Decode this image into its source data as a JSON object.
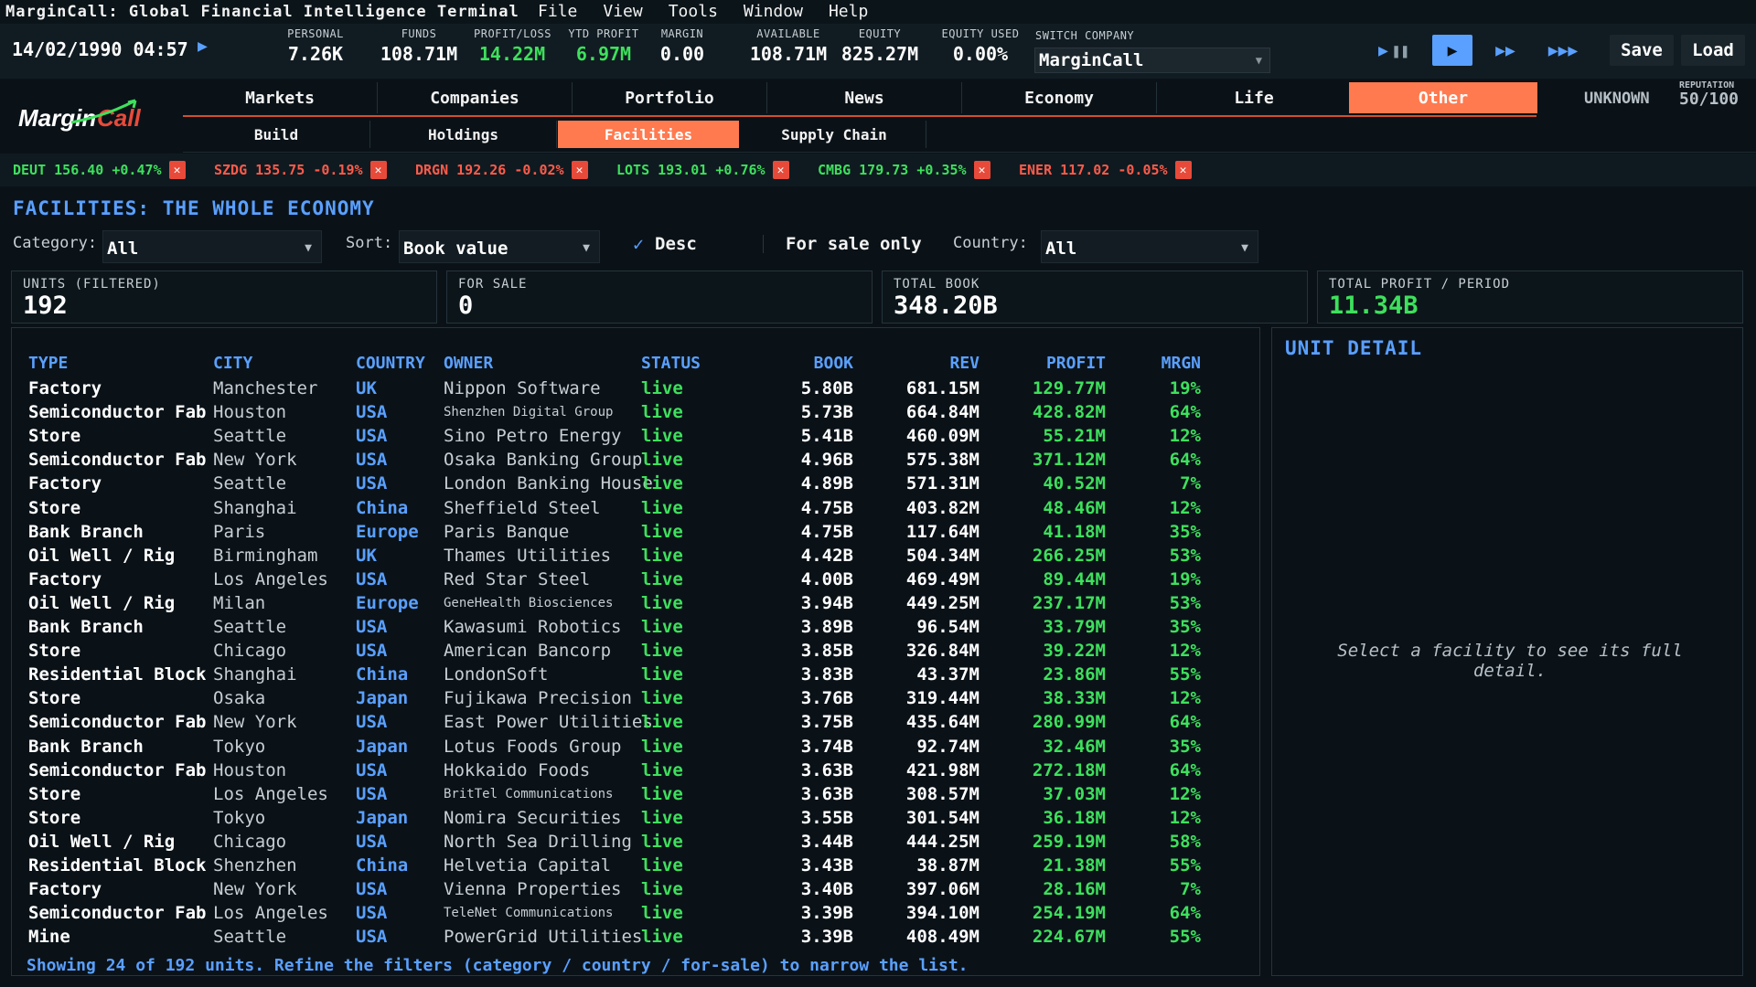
{
  "app": {
    "title": "MarginCall: Global Financial Intelligence Terminal",
    "menus": [
      "File",
      "View",
      "Tools",
      "Window",
      "Help"
    ]
  },
  "status": {
    "datetime": "14/02/1990 04:57",
    "stats": [
      {
        "label": "PERSONAL",
        "value": "7.26K",
        "color": "white"
      },
      {
        "label": "FUNDS",
        "value": "108.71M",
        "color": "white"
      },
      {
        "label": "PROFIT/LOSS",
        "value": "14.22M",
        "color": "green"
      },
      {
        "label": "YTD PROFIT",
        "value": "6.97M",
        "color": "green"
      },
      {
        "label": "MARGIN",
        "value": "0.00",
        "color": "white"
      },
      {
        "label": "AVAILABLE",
        "value": "108.71M",
        "color": "white"
      },
      {
        "label": "EQUITY",
        "value": "825.27M",
        "color": "white"
      },
      {
        "label": "EQUITY USED",
        "value": "0.00%",
        "color": "white"
      }
    ],
    "switch_company_label": "SWITCH COMPANY",
    "switch_company_value": "MarginCall",
    "save_label": "Save",
    "load_label": "Load"
  },
  "nav": {
    "tabs": [
      "Markets",
      "Companies",
      "Portfolio",
      "News",
      "Economy",
      "Life",
      "Other"
    ],
    "active_tab": "Other",
    "subtabs": [
      "Build",
      "Holdings",
      "Facilities",
      "Supply Chain"
    ],
    "active_subtab": "Facilities",
    "player_status": "UNKNOWN",
    "reputation_label": "REPUTATION",
    "reputation_value": "50/100"
  },
  "ticker": [
    {
      "text": "DEUT 156.40 +0.47%",
      "dir": "up"
    },
    {
      "text": "SZDG 135.75 -0.19%",
      "dir": "down"
    },
    {
      "text": "DRGN 192.26 -0.02%",
      "dir": "down"
    },
    {
      "text": "LOTS 193.01 +0.76%",
      "dir": "up"
    },
    {
      "text": "CMBG 179.73 +0.35%",
      "dir": "up"
    },
    {
      "text": "ENER 117.02 -0.05%",
      "dir": "down"
    }
  ],
  "page": {
    "title": "FACILITIES: THE WHOLE ECONOMY",
    "filters": {
      "category_label": "Category:",
      "category_value": "All",
      "sort_label": "Sort:",
      "sort_value": "Book value",
      "desc_label": "Desc",
      "desc_checked": true,
      "for_sale_label": "For sale only",
      "for_sale_checked": false,
      "country_label": "Country:",
      "country_value": "All"
    },
    "cards": [
      {
        "label": "UNITS (FILTERED)",
        "value": "192"
      },
      {
        "label": "FOR SALE",
        "value": "0"
      },
      {
        "label": "TOTAL BOOK",
        "value": "348.20B"
      },
      {
        "label": "TOTAL PROFIT / PERIOD",
        "value": "11.34B"
      }
    ]
  },
  "table": {
    "headers": [
      "TYPE",
      "CITY",
      "COUNTRY",
      "OWNER",
      "STATUS",
      "BOOK",
      "REV",
      "PROFIT",
      "MRGN"
    ],
    "rows": [
      [
        "Factory",
        "Manchester",
        "UK",
        "Nippon Software",
        "live",
        "5.80B",
        "681.15M",
        "129.77M",
        "19%"
      ],
      [
        "Semiconductor Fab",
        "Houston",
        "USA",
        "Shenzhen Digital Group",
        "live",
        "5.73B",
        "664.84M",
        "428.82M",
        "64%"
      ],
      [
        "Store",
        "Seattle",
        "USA",
        "Sino Petro Energy",
        "live",
        "5.41B",
        "460.09M",
        "55.21M",
        "12%"
      ],
      [
        "Semiconductor Fab",
        "New York",
        "USA",
        "Osaka Banking Group",
        "live",
        "4.96B",
        "575.38M",
        "371.12M",
        "64%"
      ],
      [
        "Factory",
        "Seattle",
        "USA",
        "London Banking House",
        "live",
        "4.89B",
        "571.31M",
        "40.52M",
        "7%"
      ],
      [
        "Store",
        "Shanghai",
        "China",
        "Sheffield Steel",
        "live",
        "4.75B",
        "403.82M",
        "48.46M",
        "12%"
      ],
      [
        "Bank Branch",
        "Paris",
        "Europe",
        "Paris Banque",
        "live",
        "4.75B",
        "117.64M",
        "41.18M",
        "35%"
      ],
      [
        "Oil Well / Rig",
        "Birmingham",
        "UK",
        "Thames Utilities",
        "live",
        "4.42B",
        "504.34M",
        "266.25M",
        "53%"
      ],
      [
        "Factory",
        "Los Angeles",
        "USA",
        "Red Star Steel",
        "live",
        "4.00B",
        "469.49M",
        "89.44M",
        "19%"
      ],
      [
        "Oil Well / Rig",
        "Milan",
        "Europe",
        "GeneHealth Biosciences",
        "live",
        "3.94B",
        "449.25M",
        "237.17M",
        "53%"
      ],
      [
        "Bank Branch",
        "Seattle",
        "USA",
        "Kawasumi Robotics",
        "live",
        "3.89B",
        "96.54M",
        "33.79M",
        "35%"
      ],
      [
        "Store",
        "Chicago",
        "USA",
        "American Bancorp",
        "live",
        "3.85B",
        "326.84M",
        "39.22M",
        "12%"
      ],
      [
        "Residential Block",
        "Shanghai",
        "China",
        "LondonSoft",
        "live",
        "3.83B",
        "43.37M",
        "23.86M",
        "55%"
      ],
      [
        "Store",
        "Osaka",
        "Japan",
        "Fujikawa Precision",
        "live",
        "3.76B",
        "319.44M",
        "38.33M",
        "12%"
      ],
      [
        "Semiconductor Fab",
        "New York",
        "USA",
        "East Power Utilities",
        "live",
        "3.75B",
        "435.64M",
        "280.99M",
        "64%"
      ],
      [
        "Bank Branch",
        "Tokyo",
        "Japan",
        "Lotus Foods Group",
        "live",
        "3.74B",
        "92.74M",
        "32.46M",
        "35%"
      ],
      [
        "Semiconductor Fab",
        "Houston",
        "USA",
        "Hokkaido Foods",
        "live",
        "3.63B",
        "421.98M",
        "272.18M",
        "64%"
      ],
      [
        "Store",
        "Los Angeles",
        "USA",
        "BritTel Communications",
        "live",
        "3.63B",
        "308.57M",
        "37.03M",
        "12%"
      ],
      [
        "Store",
        "Tokyo",
        "Japan",
        "Nomira Securities",
        "live",
        "3.55B",
        "301.54M",
        "36.18M",
        "12%"
      ],
      [
        "Oil Well / Rig",
        "Chicago",
        "USA",
        "North Sea Drilling",
        "live",
        "3.44B",
        "444.25M",
        "259.19M",
        "58%"
      ],
      [
        "Residential Block",
        "Shenzhen",
        "China",
        "Helvetia Capital",
        "live",
        "3.43B",
        "38.87M",
        "21.38M",
        "55%"
      ],
      [
        "Factory",
        "New York",
        "USA",
        "Vienna Properties",
        "live",
        "3.40B",
        "397.06M",
        "28.16M",
        "7%"
      ],
      [
        "Semiconductor Fab",
        "Los Angeles",
        "USA",
        "TeleNet Communications",
        "live",
        "3.39B",
        "394.10M",
        "254.19M",
        "64%"
      ],
      [
        "Mine",
        "Seattle",
        "USA",
        "PowerGrid Utilities",
        "live",
        "3.39B",
        "408.49M",
        "224.67M",
        "55%"
      ]
    ],
    "footer": "Showing 24 of 192 units. Refine the filters (category / country / for-sale) to narrow the list."
  },
  "detail": {
    "title": "UNIT DETAIL",
    "placeholder": "Select a facility to see its full detail."
  },
  "colors": {
    "accent": "#ff7a4f",
    "blue": "#5aa0ff",
    "green": "#3ee05c",
    "red": "#e84a3a",
    "background": "#0a1218"
  }
}
